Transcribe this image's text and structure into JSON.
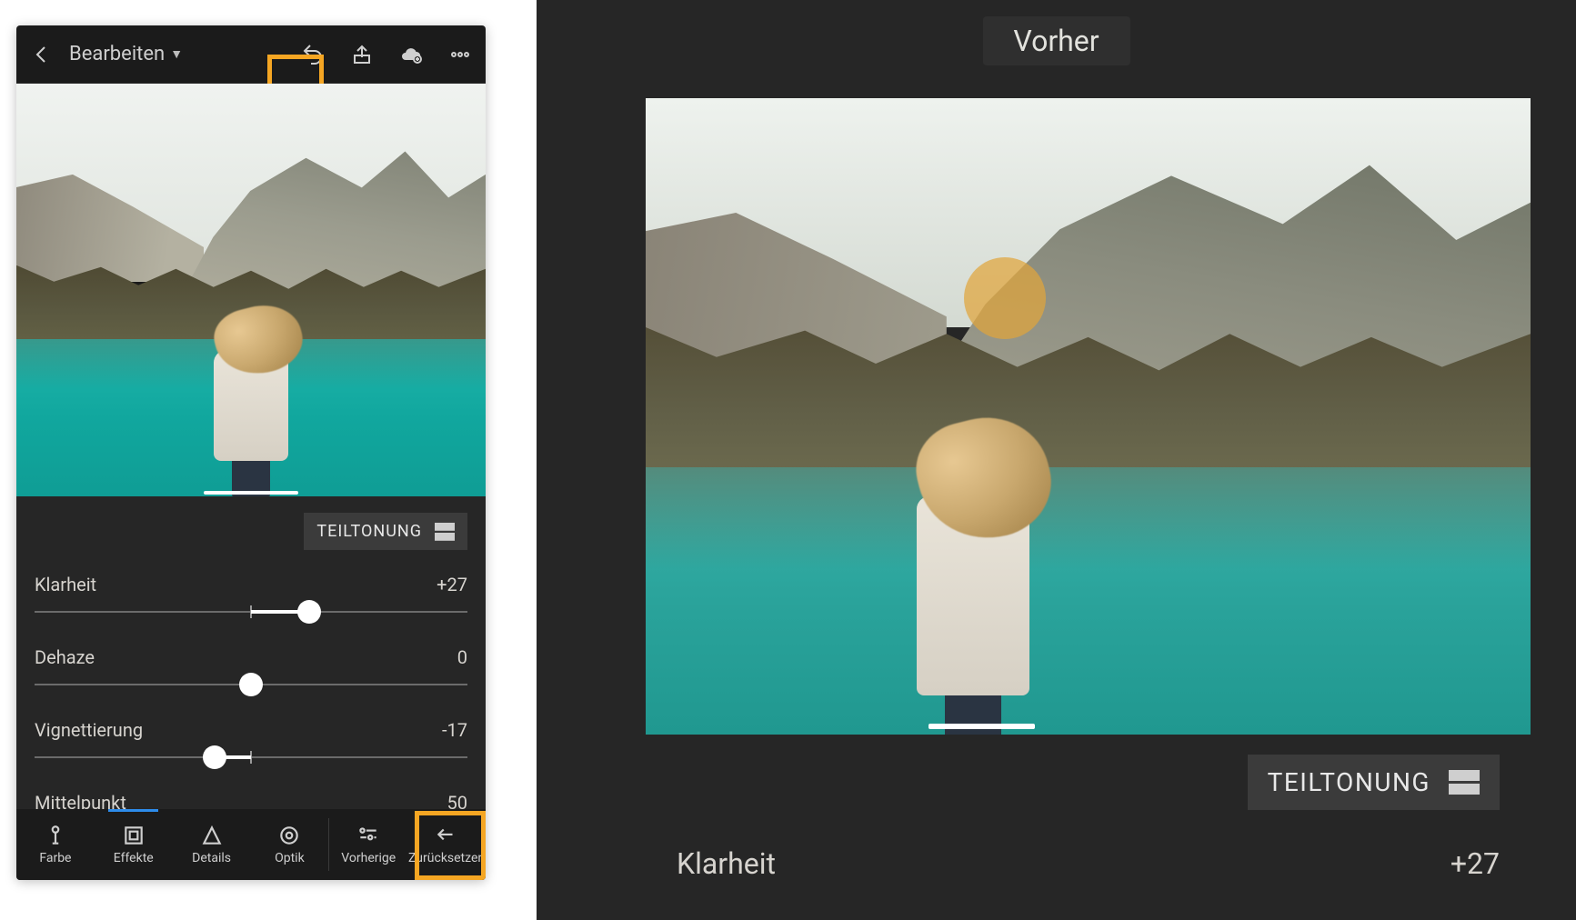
{
  "phone": {
    "header": {
      "title": "Bearbeiten"
    },
    "split_label": "TEILTONUNG",
    "sliders": [
      {
        "label": "Klarheit",
        "value_text": "+27",
        "pos": 63.5
      },
      {
        "label": "Dehaze",
        "value_text": "0",
        "pos": 50
      },
      {
        "label": "Vignettierung",
        "value_text": "-17",
        "pos": 41.5
      },
      {
        "label": "Mittelpunkt",
        "value_text": "50"
      }
    ],
    "tabs": {
      "main": [
        "Farbe",
        "Effekte",
        "Details",
        "Optik"
      ],
      "right": [
        "Vorherige",
        "Zurücksetzen"
      ],
      "active_index": 1
    }
  },
  "detail": {
    "badge": "Vorher",
    "split_label": "TEILTONUNG",
    "slider": {
      "label": "Klarheit",
      "value_text": "+27"
    }
  },
  "colors": {
    "highlight": "#f5a623",
    "accent": "#2d8ceb"
  }
}
